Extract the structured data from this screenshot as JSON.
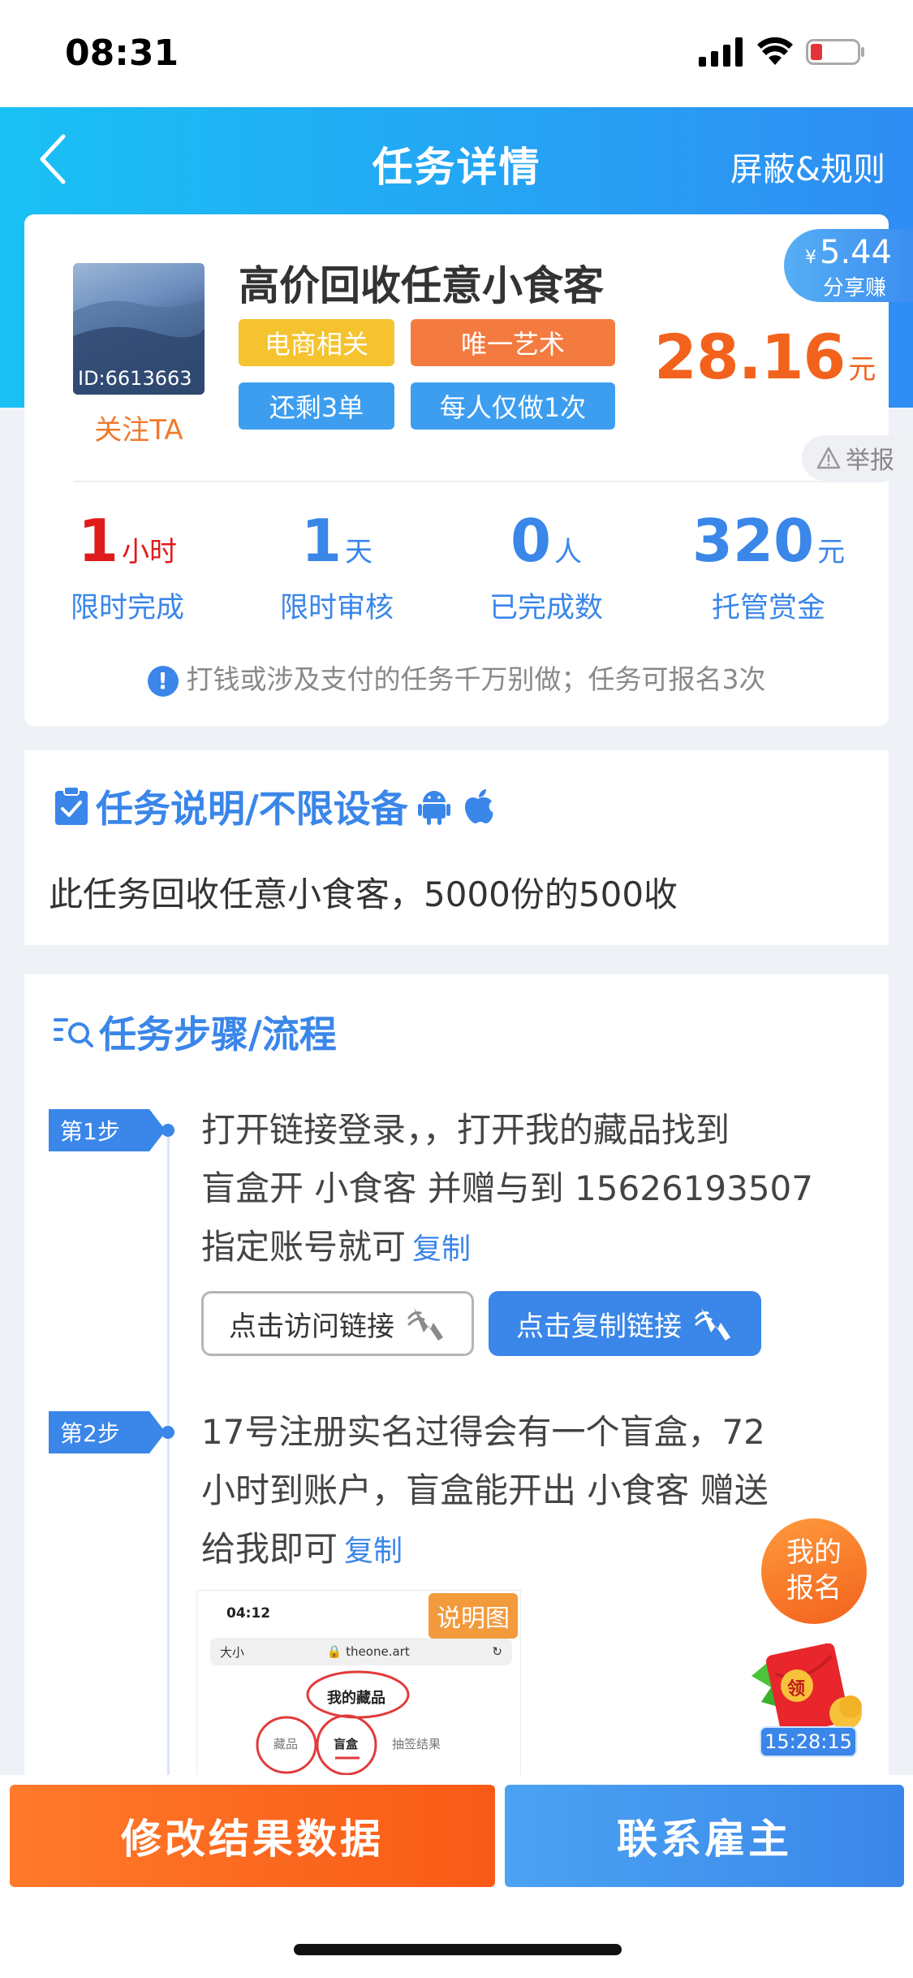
{
  "status": {
    "time": "08:31"
  },
  "header": {
    "title": "任务详情",
    "rules": "屏蔽&规则"
  },
  "task": {
    "avatar_id": "ID:6613663",
    "follow": "关注TA",
    "title": "高价回收任意小食客",
    "tags": [
      "电商相关",
      "唯一艺术",
      "还剩3单",
      "每人仅做1次"
    ],
    "price": "28.16",
    "price_unit": "元",
    "share_currency": "¥",
    "share_amount": "5.44",
    "share_label": "分享赚",
    "report": "举报"
  },
  "stats": [
    {
      "num": "1",
      "unit": "小时",
      "label": "限时完成",
      "color": "#e01b1b"
    },
    {
      "num": "1",
      "unit": "天",
      "label": "限时审核",
      "color": "#3a86e9"
    },
    {
      "num": "0",
      "unit": "人",
      "label": "已完成数",
      "color": "#3a86e9"
    },
    {
      "num": "320",
      "unit": "元",
      "label": "托管赏金",
      "color": "#3a86e9"
    }
  ],
  "notice": "打钱或涉及支付的任务千万别做；任务可报名3次",
  "description": {
    "title": "任务说明/不限设备",
    "text": "此任务回收任意小食客，5000份的500收"
  },
  "steps_section": {
    "title": "任务步骤/流程"
  },
  "steps": [
    {
      "badge": "第1步",
      "line1": "打开链接登录，，打开我的藏品找到",
      "line2": "盲盒开 小食客 并赠与到 15626193507",
      "line3": "指定账号就可",
      "copy": "复制",
      "visit_btn": "点击访问链接",
      "copy_btn": "点击复制链接"
    },
    {
      "badge": "第2步",
      "line1": "17号注册实名过得会有一个盲盒，72",
      "line2": "小时到账户，盲盒能开出 小食客 赠送",
      "line3": "给我即可",
      "copy": "复制"
    }
  ],
  "illustration": {
    "badge": "说明图",
    "time": "04:12",
    "font_label": "大小",
    "url": "theone.art",
    "heading": "我的藏品",
    "tabs": [
      "藏品",
      "盲盒",
      "抽签结果"
    ]
  },
  "float": {
    "signup_line1": "我的",
    "signup_line2": "报名",
    "packet": "领",
    "timer": "15:28:15"
  },
  "bottom": {
    "modify": "修改结果数据",
    "contact": "联系雇主"
  }
}
